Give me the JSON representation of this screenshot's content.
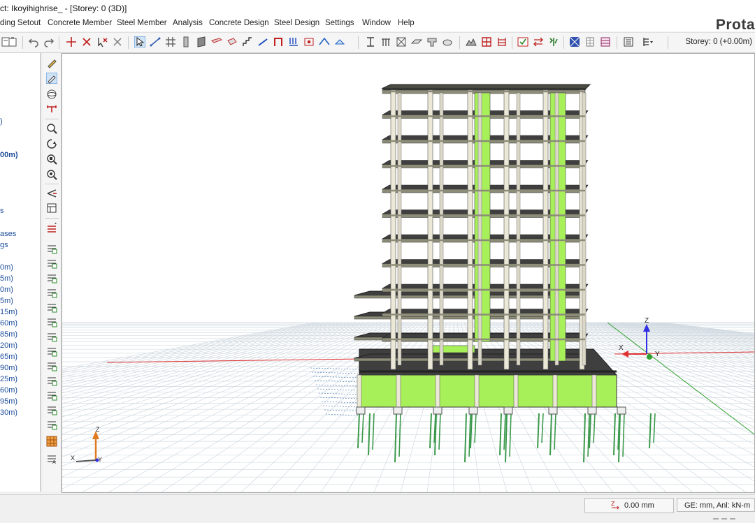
{
  "window": {
    "title": "ct: Ikoyihighrise_ - [Storey: 0 (3D)]"
  },
  "brand": "Prota",
  "menu": [
    {
      "label": "ding Setout"
    },
    {
      "label": "Concrete Member"
    },
    {
      "label": "Steel Member"
    },
    {
      "label": "Analysis"
    },
    {
      "label": "Concrete Design"
    },
    {
      "label": "Steel Design"
    },
    {
      "label": "Settings"
    },
    {
      "label": "Window"
    },
    {
      "label": "Help"
    }
  ],
  "toolbar": {
    "storey_label": "Storey: 0 (+0.00m)"
  },
  "left_panel": {
    "items": [
      {
        "label": ")"
      },
      {
        "label": "00m)"
      },
      {
        "label": "s"
      },
      {
        "label": "ases"
      },
      {
        "label": "gs"
      },
      {
        "label": "0m)"
      },
      {
        "label": "5m)"
      },
      {
        "label": "0m)"
      },
      {
        "label": "5m)"
      },
      {
        "label": "15m)"
      },
      {
        "label": "60m)"
      },
      {
        "label": "85m)"
      },
      {
        "label": "20m)"
      },
      {
        "label": "65m)"
      },
      {
        "label": "90m)"
      },
      {
        "label": "25m)"
      },
      {
        "label": "60m)"
      },
      {
        "label": "95m)"
      },
      {
        "label": "30m)"
      }
    ]
  },
  "viewport": {
    "axis_labels": {
      "x": "X",
      "y": "Y",
      "z": "Z"
    },
    "colors": {
      "slab": "#3f3f3f",
      "wall": "#a8f05a",
      "column": "#ece8d8",
      "beam": "#8c8c78",
      "pile": "#3c9a4c",
      "x_axis": "#e03030",
      "y_axis": "#30a030",
      "z_axis": "#3030e0"
    }
  },
  "status": {
    "elevation": "0.00 mm",
    "units": "GE: mm,  Anl: kN-m"
  }
}
